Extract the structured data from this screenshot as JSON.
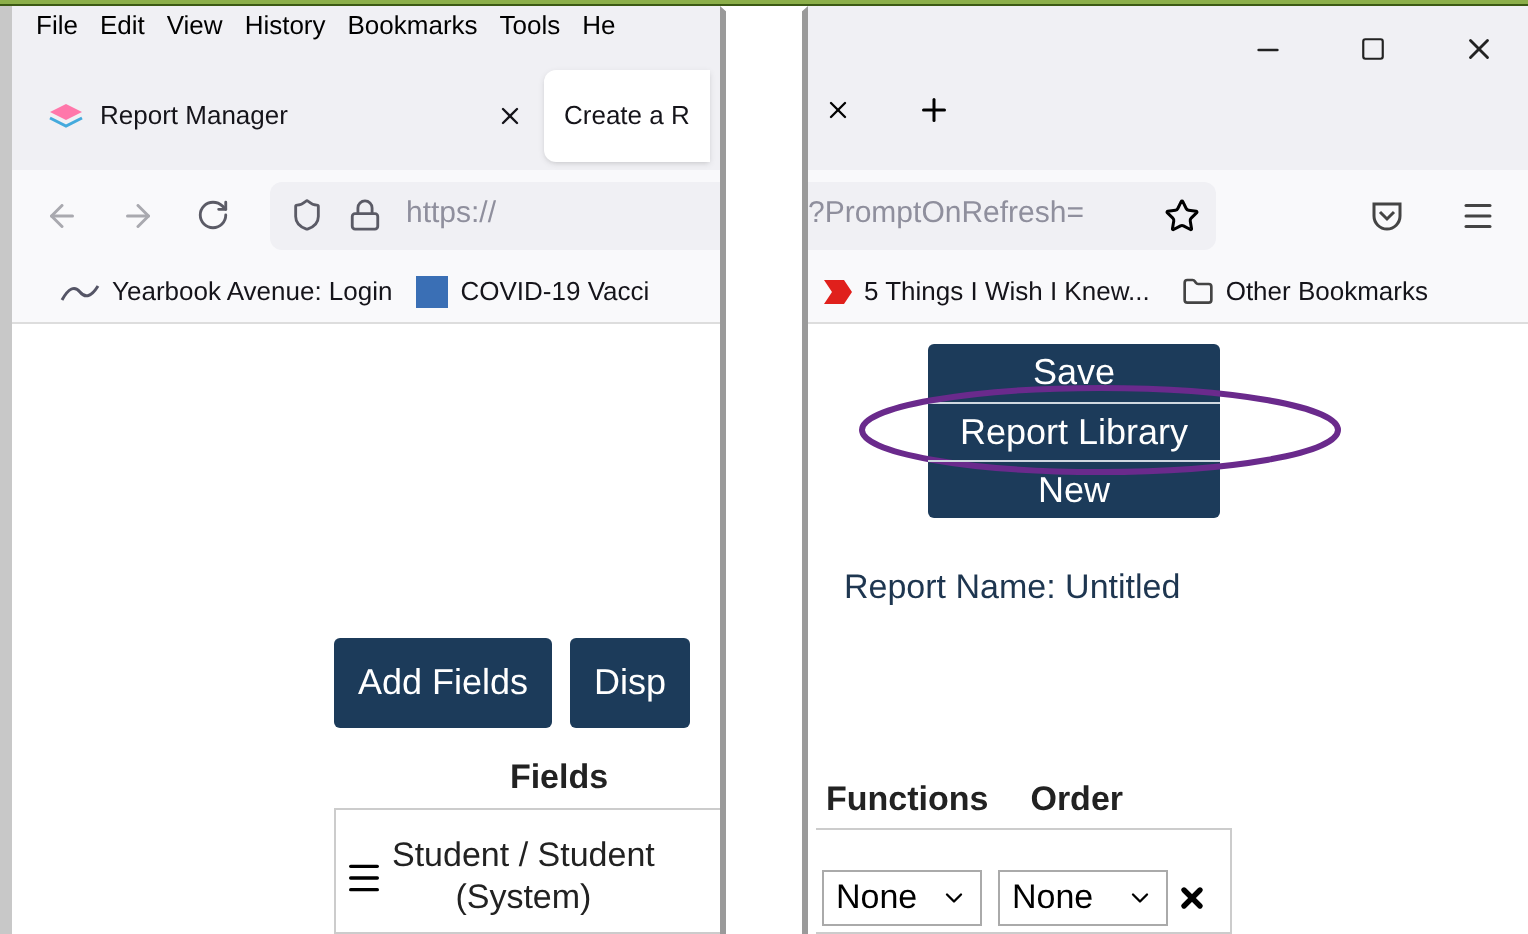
{
  "menu_bar": [
    "File",
    "Edit",
    "View",
    "History",
    "Bookmarks",
    "Tools",
    "He"
  ],
  "tabs": [
    {
      "label": "Report Manager",
      "selected": false
    },
    {
      "label": "Create a R",
      "selected": true
    }
  ],
  "address_bar": {
    "url_start": "https://",
    "url_end": "?PromptOnRefresh="
  },
  "bookmarks": [
    {
      "label": "Yearbook Avenue: Login"
    },
    {
      "label": "COVID-19 Vacci"
    },
    {
      "label": "5 Things I Wish I Knew..."
    },
    {
      "label": "Other Bookmarks"
    }
  ],
  "report_menu": [
    {
      "label": "Save",
      "circled": false
    },
    {
      "label": "Report Library",
      "circled": true
    },
    {
      "label": "New",
      "circled": false
    }
  ],
  "report_name": "Report Name: Untitled",
  "buttons": [
    "Add Fields",
    "Disp"
  ],
  "field_table": {
    "columns": [
      "Fields",
      "Functions",
      "Order"
    ],
    "rows": [
      {
        "field": "Student / Student",
        "field_line_2": "(System)",
        "function": "None",
        "order": "None"
      }
    ]
  }
}
